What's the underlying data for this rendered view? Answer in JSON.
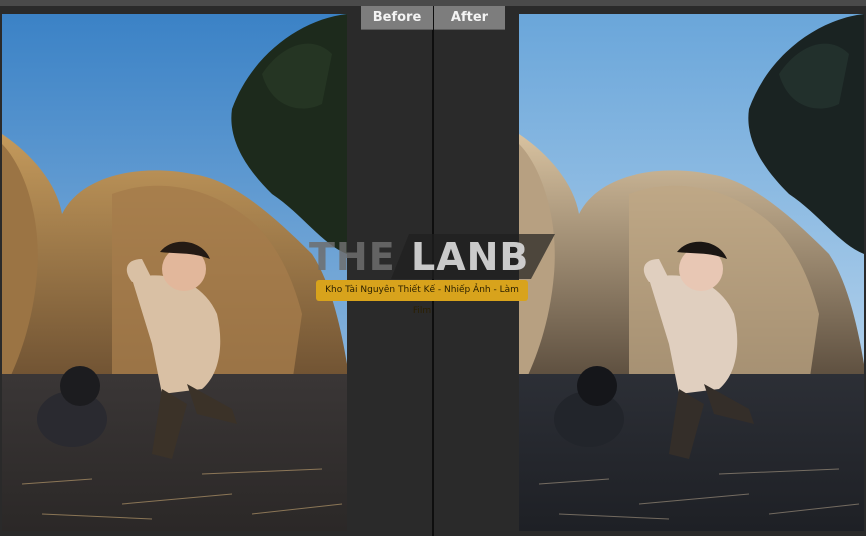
{
  "toolbar": {
    "before_label": "Before",
    "after_label": "After"
  },
  "watermark": {
    "brand_left": "THE",
    "brand_right": "LANB",
    "tagline": "Kho Tài Nguyên Thiết Kế - Nhiếp Ảnh - Làm Film"
  },
  "colors": {
    "background": "#2a2a2a",
    "tab_background": "#7d7d7d",
    "divider": "#0e0e0e",
    "watermark_band": "#d8a31c"
  }
}
